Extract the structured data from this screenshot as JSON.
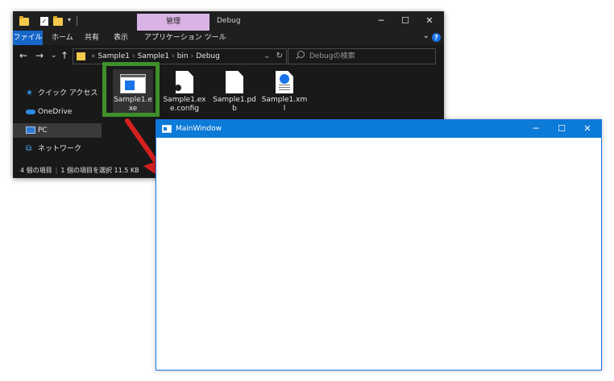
{
  "explorer": {
    "contextual_tab": "管理",
    "window_title": "Debug",
    "window_buttons": {
      "minimize": "─",
      "maximize": "☐",
      "close": "✕"
    },
    "ribbon_tabs": [
      "ファイル",
      "ホーム",
      "共有",
      "表示",
      "アプリケーション ツール"
    ],
    "ribbon_chevron": "⌄",
    "help": "?",
    "nav_buttons": {
      "back": "←",
      "forward": "→",
      "recent": "⌄",
      "up": "↑"
    },
    "address": {
      "prefix": "«",
      "segments": [
        "Sample1",
        "Sample1",
        "bin",
        "Debug"
      ],
      "separator": "›",
      "dropdown": "⌄",
      "refresh": "↻"
    },
    "search": {
      "placeholder": "Debugの検索"
    },
    "nav_pane": [
      {
        "label": "クイック アクセス",
        "icon": "star-icon"
      },
      {
        "label": "OneDrive",
        "icon": "cloud-icon"
      },
      {
        "label": "PC",
        "icon": "computer-icon",
        "selected": true
      },
      {
        "label": "ネットワーク",
        "icon": "network-icon"
      }
    ],
    "files": [
      {
        "name": "Sample1.exe",
        "icon": "exe-icon",
        "selected": true
      },
      {
        "name": "Sample1.exe.config",
        "icon": "config-icon"
      },
      {
        "name": "Sample1.pdb",
        "icon": "document-icon"
      },
      {
        "name": "Sample1.xml",
        "icon": "xml-icon"
      }
    ],
    "status": {
      "item_count": "4 個の項目",
      "selection": "1 個の項目を選択  11.5 KB"
    }
  },
  "colors": {
    "highlight": "#3f8f2a",
    "arrow": "#d62020",
    "accent": "#0c7ad7",
    "contextual_tab": "#d9b3e6"
  },
  "main_window": {
    "title": "MainWindow",
    "buttons": {
      "minimize": "─",
      "maximize": "☐",
      "close": "✕"
    }
  }
}
